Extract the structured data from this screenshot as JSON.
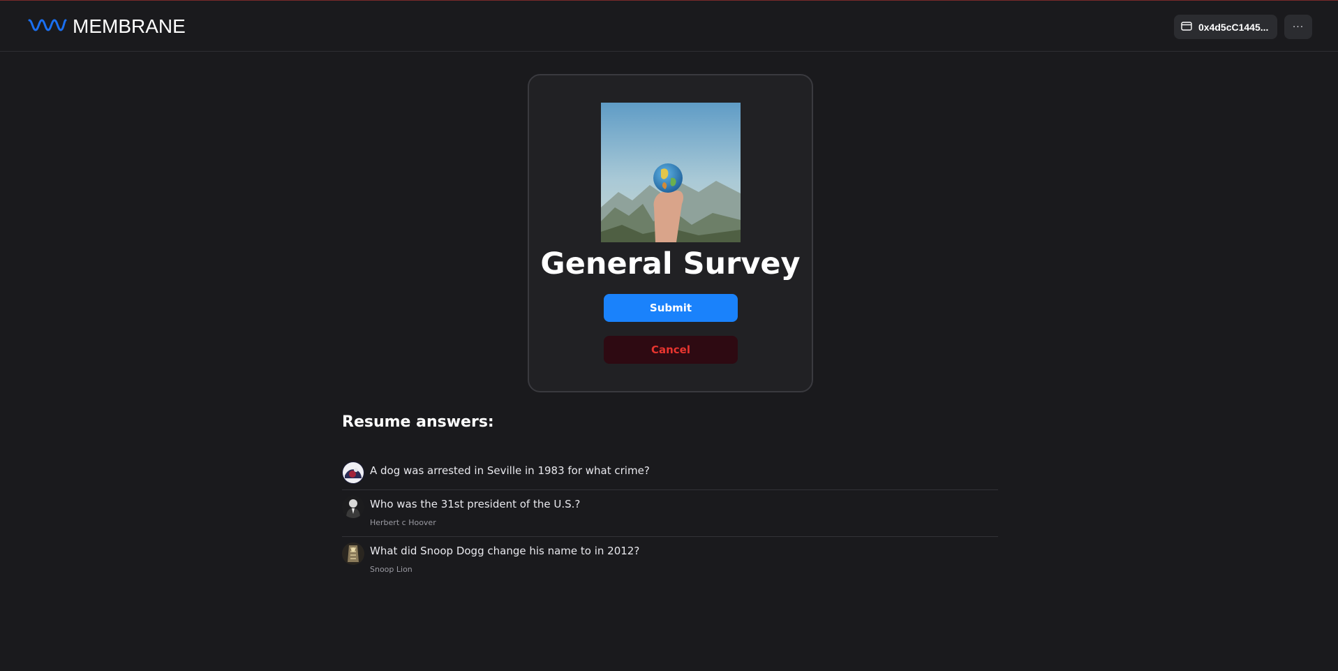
{
  "header": {
    "brand": "MEMBRANE",
    "wallet_address": "0x4d5cC1445...",
    "more_label": "···"
  },
  "colors": {
    "accent": "#1a82fb",
    "danger": "#e8352f",
    "background": "#1a1a1d"
  },
  "survey": {
    "title": "General Survey",
    "submit_label": "Submit",
    "cancel_label": "Cancel"
  },
  "resume": {
    "title": "Resume answers:",
    "items": [
      {
        "question": "A dog was arrested in Seville in 1983 for what crime?",
        "answer": ""
      },
      {
        "question": "Who was the 31st president of the U.S.?",
        "answer": "Herbert c Hoover"
      },
      {
        "question": "What did Snoop Dogg change his name to in 2012?",
        "answer": "Snoop Lion"
      }
    ]
  }
}
